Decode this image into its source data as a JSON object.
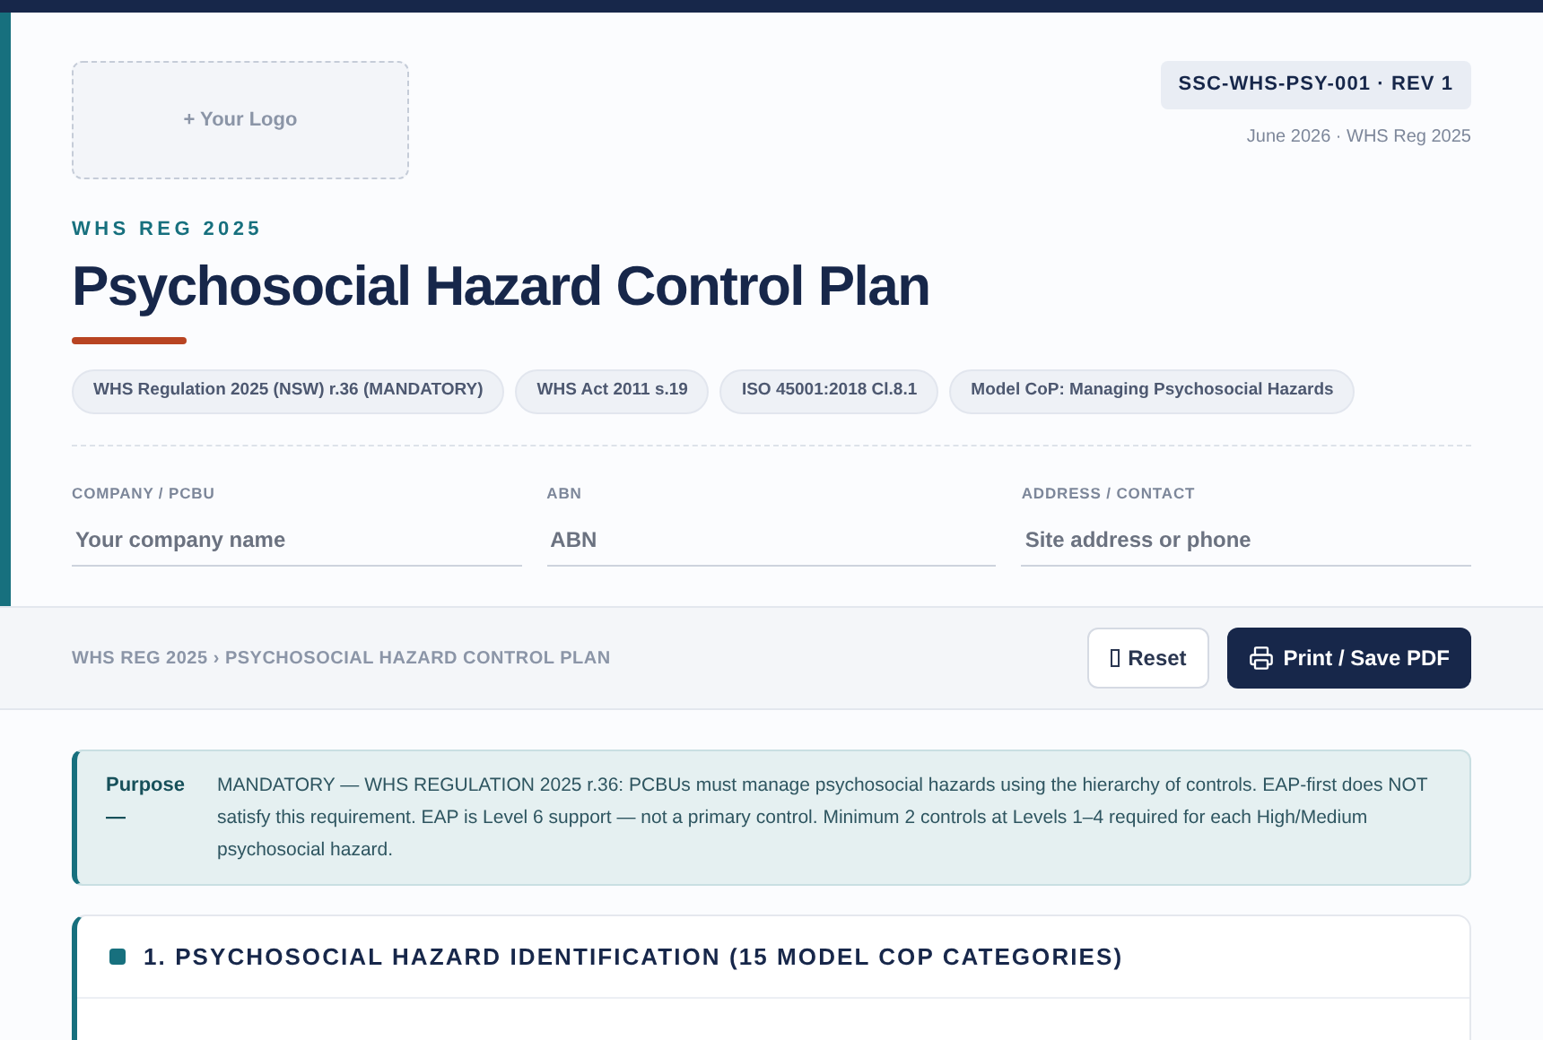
{
  "logo_placeholder": "+ Your Logo",
  "doc_code": "SSC-WHS-PSY-001 · REV 1",
  "doc_date": "June 2026 · WHS Reg 2025",
  "eyebrow": "WHS REG 2025",
  "title": "Psychosocial Hazard Control Plan",
  "tags": [
    "WHS Regulation 2025 (NSW) r.36 (MANDATORY)",
    "WHS Act 2011 s.19",
    "ISO 45001:2018 Cl.8.1",
    "Model CoP: Managing Psychosocial Hazards"
  ],
  "fields": [
    {
      "label": "COMPANY / PCBU",
      "placeholder": "Your company name"
    },
    {
      "label": "ABN",
      "placeholder": "ABN"
    },
    {
      "label": "ADDRESS / CONTACT",
      "placeholder": "Site address or phone"
    }
  ],
  "breadcrumb": "WHS REG 2025 › PSYCHOSOCIAL HAZARD CONTROL PLAN",
  "buttons": [
    {
      "kind": "secondary",
      "label": "Reset"
    },
    {
      "kind": "primary",
      "label": "Print / Save PDF"
    }
  ],
  "purpose": {
    "label": "Purpose —",
    "text": "MANDATORY — WHS REGULATION 2025 r.36: PCBUs must manage psychosocial hazards using the hierarchy of controls. EAP-first does NOT satisfy this requirement. EAP is Level 6 support — not a primary control. Minimum 2 controls at Levels 1–4 required for each High/Medium psychosocial hazard."
  },
  "section": {
    "title": "1. PSYCHOSOCIAL HAZARD IDENTIFICATION (15 MODEL COP CATEGORIES)"
  }
}
